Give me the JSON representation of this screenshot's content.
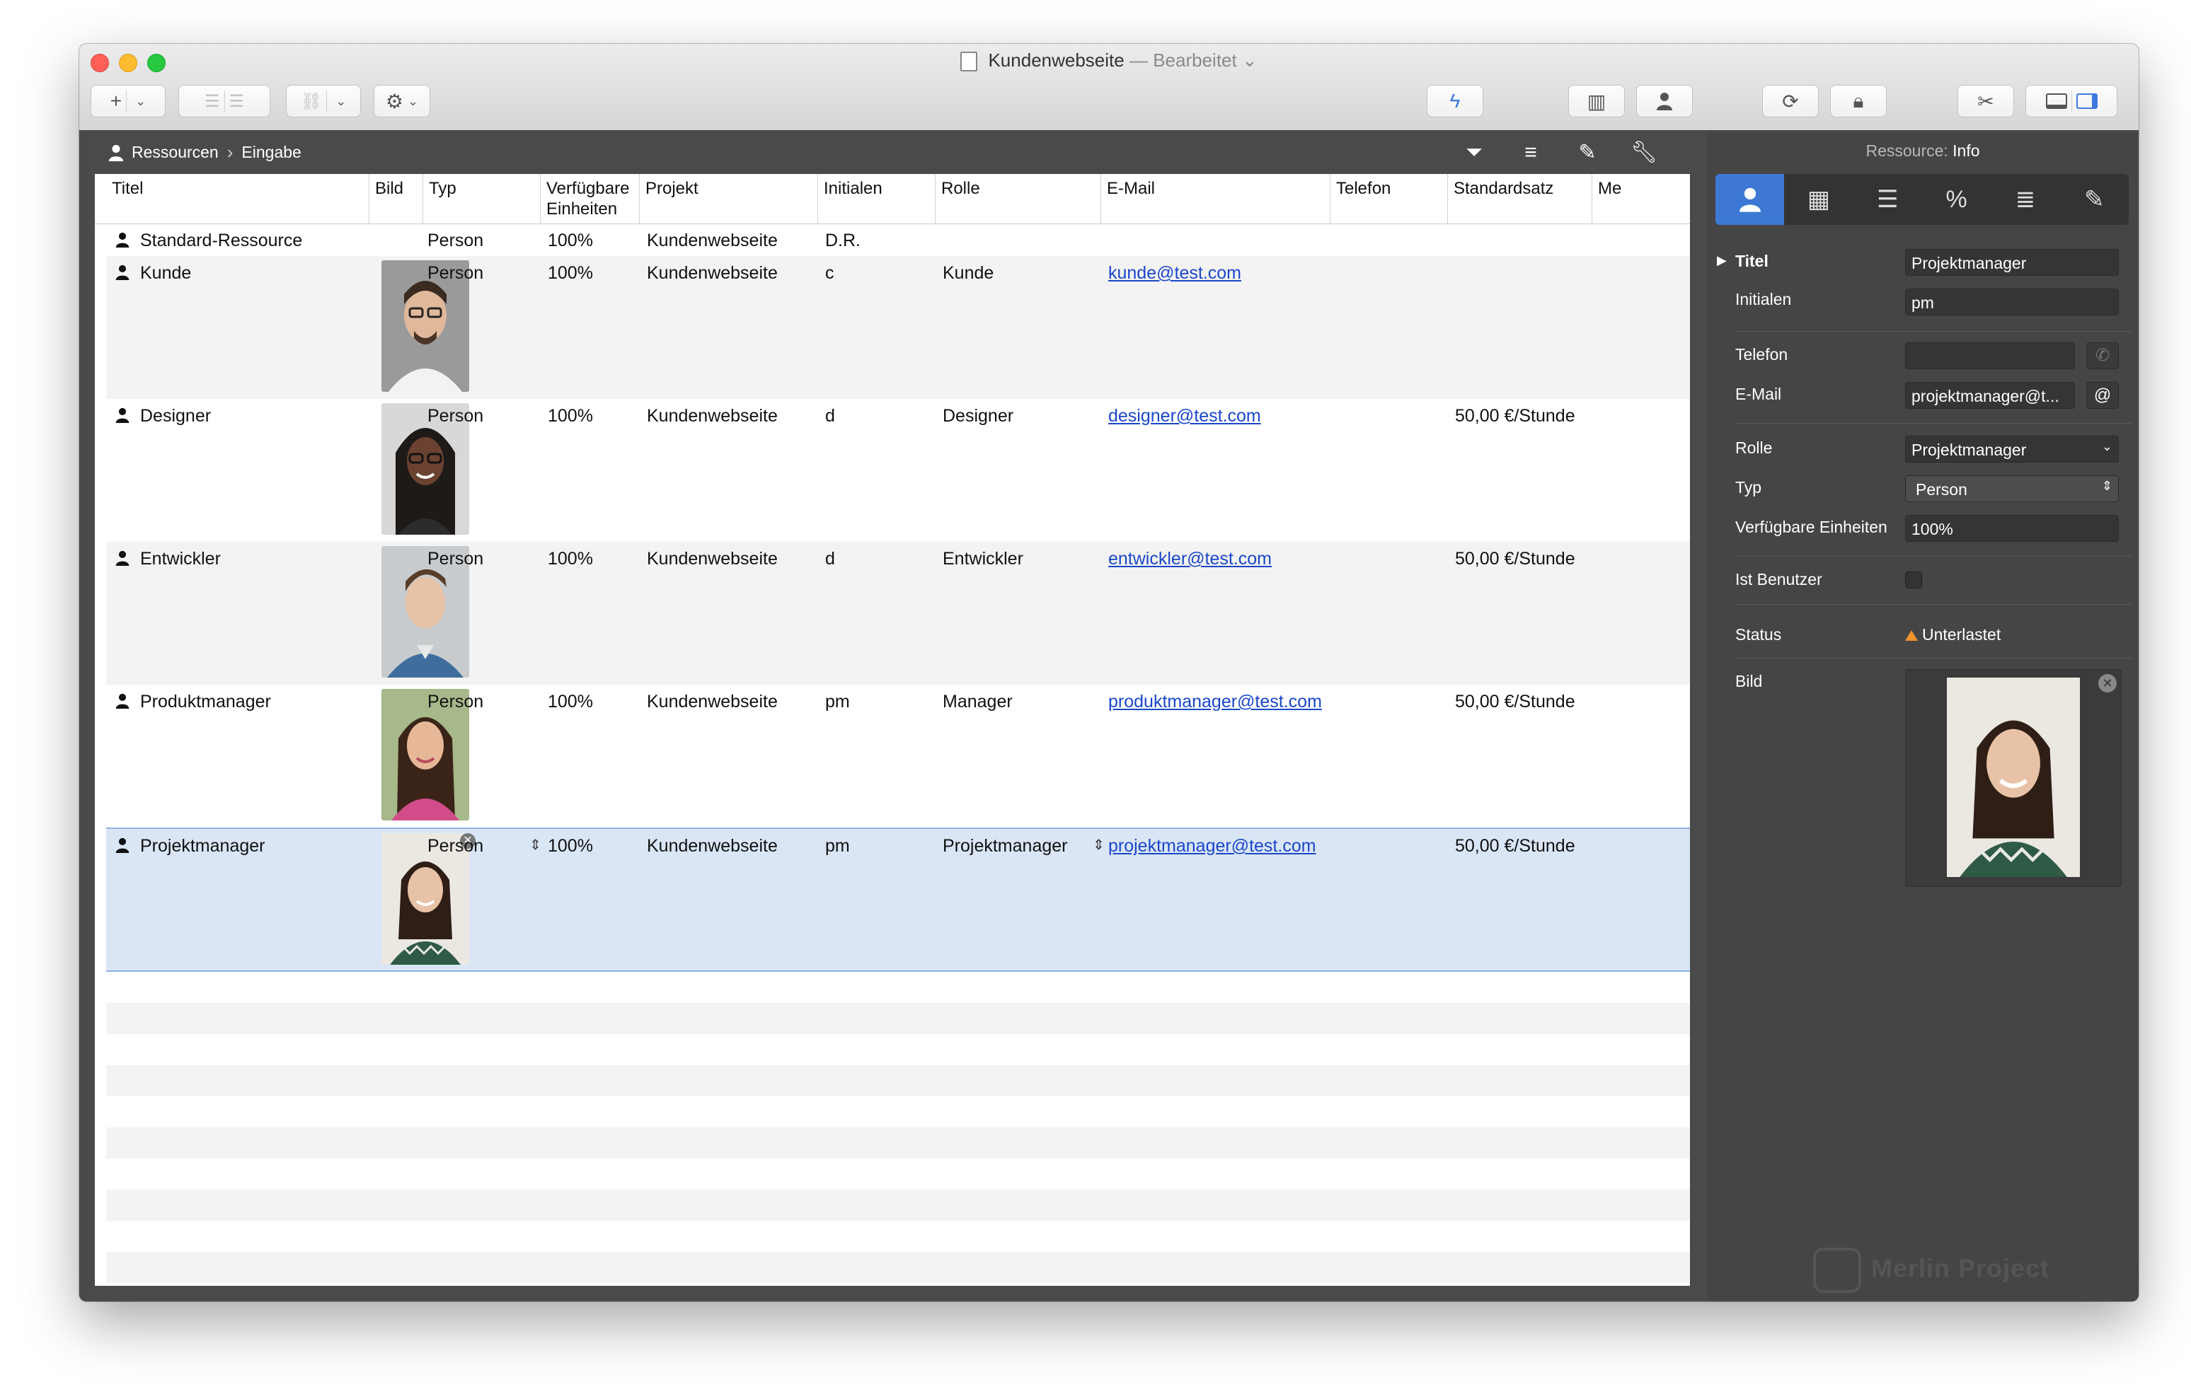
{
  "window": {
    "title": "Kundenwebseite",
    "separator": "—",
    "state": "Bearbeitet"
  },
  "toolbar": {
    "add_icon": "plus-icon",
    "indent_icon": "indent-icon",
    "outdent_icon": "outdent-icon",
    "link_icon": "link-icon",
    "gear_icon": "gear-icon",
    "bolt_icon": "bolt-icon",
    "library_icon": "library-icon",
    "user_icon": "person-icon",
    "sync_icon": "sync-icon",
    "lock_icon": "lock-icon",
    "tools_icon": "tools-icon",
    "bottom_panel_icon": "bottom-panel-icon",
    "right_panel_icon": "right-panel-icon"
  },
  "breadcrumb": {
    "root": "Ressourcen",
    "current": "Eingabe"
  },
  "table": {
    "columns": [
      "Titel",
      "Bild",
      "Typ",
      "Verfügbare Einheiten",
      "Projekt",
      "Initialen",
      "Rolle",
      "E-Mail",
      "Telefon",
      "Standardsatz",
      "Me"
    ],
    "rows": [
      {
        "title": "Standard-Ressource",
        "typ": "Person",
        "einheiten": "100%",
        "projekt": "Kundenwebseite",
        "initialen": "D.R.",
        "rolle": "",
        "email": "",
        "telefon": "",
        "satz": ""
      },
      {
        "title": "Kunde",
        "typ": "Person",
        "einheiten": "100%",
        "projekt": "Kundenwebseite",
        "initialen": "c",
        "rolle": "Kunde",
        "email": "kunde@test.com",
        "telefon": "",
        "satz": ""
      },
      {
        "title": "Designer",
        "typ": "Person",
        "einheiten": "100%",
        "projekt": "Kundenwebseite",
        "initialen": "d",
        "rolle": "Designer",
        "email": "designer@test.com",
        "telefon": "",
        "satz": "50,00 €/Stunde"
      },
      {
        "title": "Entwickler",
        "typ": "Person",
        "einheiten": "100%",
        "projekt": "Kundenwebseite",
        "initialen": "d",
        "rolle": "Entwickler",
        "email": "entwickler@test.com",
        "telefon": "",
        "satz": "50,00 €/Stunde"
      },
      {
        "title": "Produktmanager",
        "typ": "Person",
        "einheiten": "100%",
        "projekt": "Kundenwebseite",
        "initialen": "pm",
        "rolle": "Manager",
        "email": "produktmanager@test.com",
        "telefon": "",
        "satz": "50,00 €/Stunde"
      },
      {
        "title": "Projektmanager",
        "typ": "Person",
        "einheiten": "100%",
        "projekt": "Kundenwebseite",
        "initialen": "pm",
        "rolle": "Projektmanager",
        "email": "projektmanager@test.com",
        "telefon": "",
        "satz": "50,00 €/Stunde"
      }
    ]
  },
  "inspector": {
    "heading_prefix": "Ressource:",
    "heading": "Info",
    "tabs": [
      "person-icon",
      "calendar-icon",
      "cost-icon",
      "percent-icon",
      "list-icon",
      "edit-icon"
    ],
    "fields": {
      "titel_label": "Titel",
      "titel_value": "Projektmanager",
      "initialen_label": "Initialen",
      "initialen_value": "pm",
      "telefon_label": "Telefon",
      "telefon_value": "",
      "email_label": "E-Mail",
      "email_value": "projektmanager@t...",
      "rolle_label": "Rolle",
      "rolle_value": "Projektmanager",
      "typ_label": "Typ",
      "typ_value": "Person",
      "einheiten_label": "Verfügbare Einheiten",
      "einheiten_value": "100%",
      "benutzer_label": "Ist Benutzer",
      "status_label": "Status",
      "status_value": "Unterlastet",
      "bild_label": "Bild"
    },
    "watermark": "Merlin Project"
  }
}
